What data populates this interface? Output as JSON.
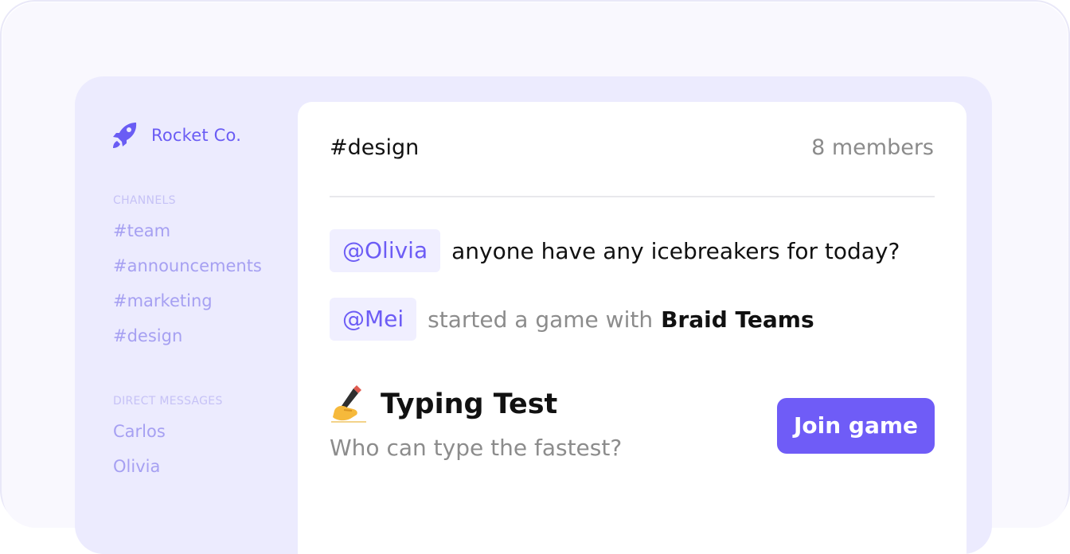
{
  "workspace": {
    "name": "Rocket Co.",
    "logo_icon": "rocket-icon",
    "accent_color": "#6a5cf4"
  },
  "sidebar": {
    "channels_label": "CHANNELS",
    "channels": [
      "#team",
      "#announcements",
      "#marketing",
      "#design"
    ],
    "dm_label": "DIRECT MESSAGES",
    "direct_messages": [
      "Carlos",
      "Olivia"
    ]
  },
  "channel": {
    "title": "#design",
    "members": "8 members"
  },
  "messages": [
    {
      "mention": "@Olivia",
      "text": "anyone have any icebreakers for today?"
    },
    {
      "mention": "@Mei",
      "text": "started a game with",
      "strong": "Braid Teams"
    }
  ],
  "game": {
    "icon": "writing-hand-icon",
    "title": "Typing Test",
    "subtitle": "Who can type the fastest?",
    "button_label": "Join game",
    "button_color": "#6f5cf7"
  }
}
